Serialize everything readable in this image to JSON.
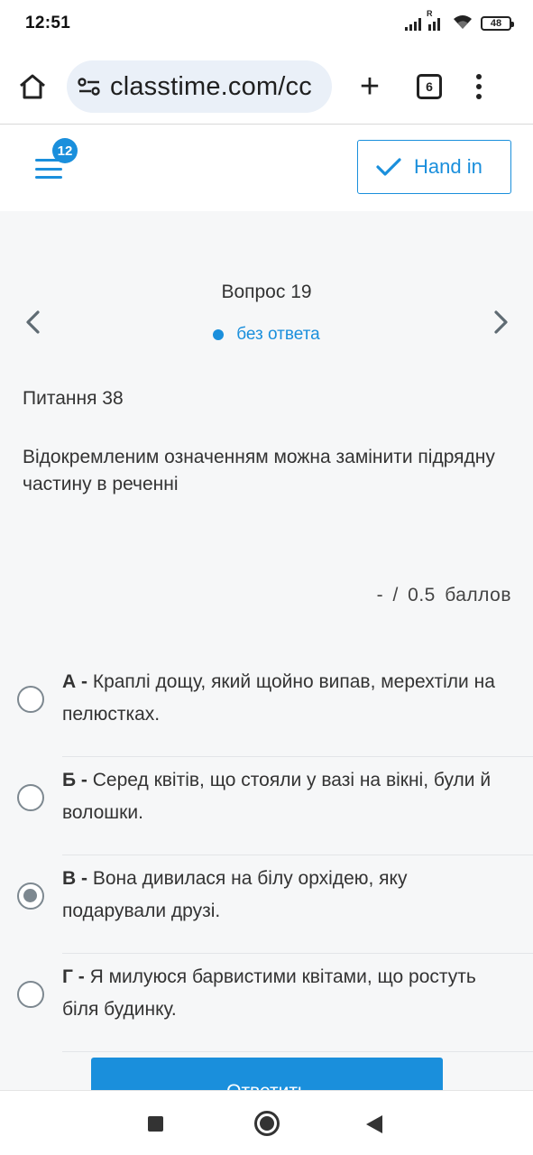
{
  "status_bar": {
    "time": "12:51",
    "battery": "48",
    "roaming_label": "R",
    "icons": [
      "signal-icon",
      "signal-roaming-icon",
      "wifi-icon",
      "battery-icon"
    ]
  },
  "browser": {
    "url": "classtime.com/cc",
    "tab_count": "6",
    "icons": [
      "home-icon",
      "site-settings-icon",
      "plus-icon",
      "tabs-icon",
      "more-vert-icon"
    ]
  },
  "app_header": {
    "notification_count": "12",
    "hand_in_label": "Hand in",
    "accent_color": "#1a8fdc"
  },
  "question": {
    "number_label": "Вопрос 19",
    "status_label": "без ответа",
    "title": "Питання 38",
    "text": "Відокремленим означенням можна замінити підрядну частину в реченні",
    "score": "-  /  0.5  баллов"
  },
  "options": [
    {
      "letter": "А -",
      "text": " Краплі дощу, який щойно випав, мерехтіли на пелюстках.",
      "selected": false
    },
    {
      "letter": "Б -",
      "text": " Серед квітів, що стояли у вазі на вікні, були й волошки.",
      "selected": false
    },
    {
      "letter": "В -",
      "text": " Вона дивилася на білу орхідею, яку подарували друзі.",
      "selected": true
    },
    {
      "letter": "Г -",
      "text": " Я милуюся барвистими квітами, що ростуть біля будинку.",
      "selected": false
    }
  ],
  "submit_label": "Ответить"
}
